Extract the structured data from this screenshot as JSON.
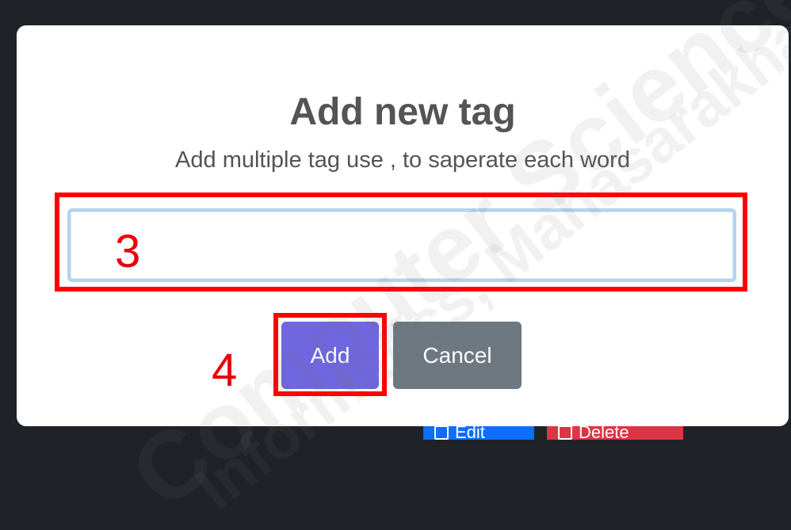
{
  "backdrop": {
    "edit_label": "Edit",
    "delete_label": "Delete"
  },
  "modal": {
    "title": "Add new tag",
    "subtitle": "Add multiple tag use , to saperate each word",
    "input": {
      "value": "",
      "placeholder": ""
    },
    "add_label": "Add",
    "cancel_label": "Cancel"
  },
  "annotations": {
    "step_input": "3",
    "step_add": "4",
    "color": "#ff0000"
  },
  "watermark": {
    "line1": "Computer Science Department",
    "line2": "Informatics, Mahasarakham"
  },
  "colors": {
    "add_button": "#7066e0",
    "cancel_button": "#6e7881",
    "edit_button": "#0d6efd",
    "delete_button": "#dc3545"
  }
}
